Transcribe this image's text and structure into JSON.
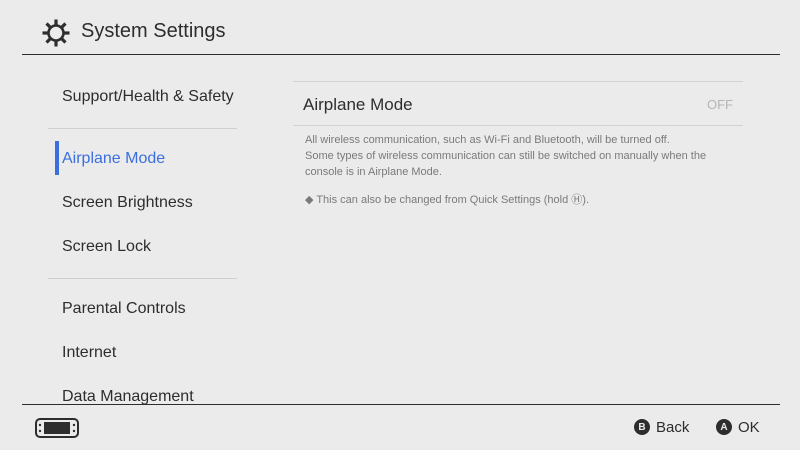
{
  "header": {
    "title": "System Settings",
    "icon": "gear-icon"
  },
  "sidebar": {
    "items": [
      {
        "label": "Support/Health & Safety"
      },
      {
        "label": "Airplane Mode"
      },
      {
        "label": "Screen Brightness"
      },
      {
        "label": "Screen Lock"
      },
      {
        "label": "Parental Controls"
      },
      {
        "label": "Internet"
      },
      {
        "label": "Data Management"
      }
    ],
    "active_index": 1,
    "accent": "#3b6fde"
  },
  "main": {
    "setting_label": "Airplane Mode",
    "setting_value": "OFF",
    "description_1": "All wireless communication, such as Wi-Fi and Bluetooth, will be turned off.",
    "description_2": "Some types of wireless communication can still be switched on manually when the console is in Airplane Mode.",
    "note": "◆ This can also be changed from Quick Settings (hold Ⓗ)."
  },
  "footer": {
    "console_icon": "switch-console-icon",
    "back_button_glyph": "B",
    "back_label": "Back",
    "ok_button_glyph": "A",
    "ok_label": "OK"
  }
}
